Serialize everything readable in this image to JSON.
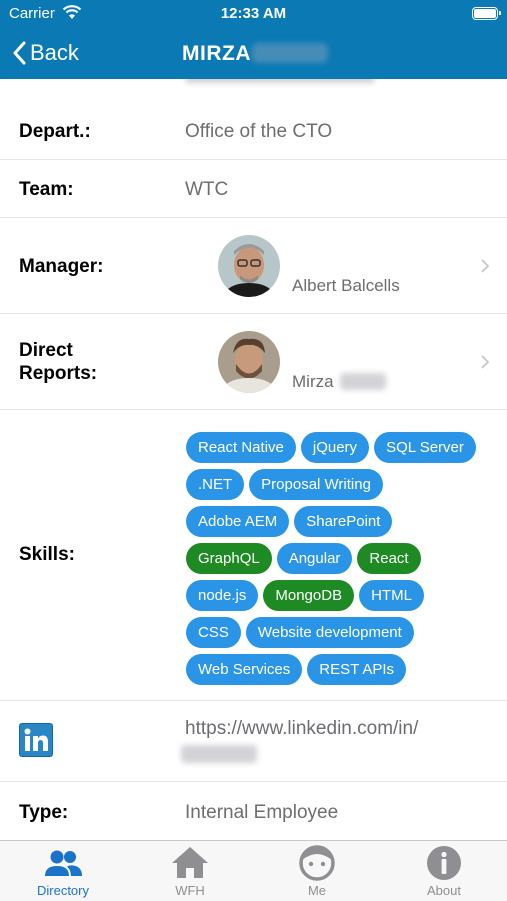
{
  "status_bar": {
    "carrier": "Carrier",
    "time": "12:33 AM"
  },
  "nav": {
    "back_label": "Back",
    "title": "MIRZA"
  },
  "profile": {
    "department": {
      "label": "Depart.:",
      "value": "Office of the CTO"
    },
    "team": {
      "label": "Team:",
      "value": "WTC"
    },
    "manager": {
      "label": "Manager:",
      "name": "Albert Balcells"
    },
    "direct_reports": {
      "label_line1": "Direct",
      "label_line2": "Reports:",
      "name": "Mirza"
    },
    "skills": {
      "label": "Skills:",
      "rows": [
        [
          {
            "name": "React Native",
            "color": "blue"
          },
          {
            "name": "jQuery",
            "color": "blue"
          },
          {
            "name": "SQL Server",
            "color": "blue"
          }
        ],
        [
          {
            "name": ".NET",
            "color": "blue"
          },
          {
            "name": "Proposal Writing",
            "color": "blue"
          }
        ],
        [
          {
            "name": "Adobe AEM",
            "color": "blue"
          },
          {
            "name": "SharePoint",
            "color": "blue"
          }
        ],
        [
          {
            "name": "GraphQL",
            "color": "green"
          },
          {
            "name": "Angular",
            "color": "blue"
          },
          {
            "name": "React",
            "color": "green"
          }
        ],
        [
          {
            "name": "node.js",
            "color": "blue"
          },
          {
            "name": "MongoDB",
            "color": "green"
          },
          {
            "name": "HTML",
            "color": "blue"
          }
        ],
        [
          {
            "name": "CSS",
            "color": "blue"
          },
          {
            "name": "Website development",
            "color": "blue"
          }
        ],
        [
          {
            "name": "Web Services",
            "color": "blue"
          },
          {
            "name": "REST APIs",
            "color": "blue"
          }
        ]
      ]
    },
    "linkedin": {
      "icon": "linkedin-icon",
      "url": "https://www.linkedin.com/in/"
    },
    "type": {
      "label": "Type:",
      "value": "Internal Employee"
    }
  },
  "tabs": [
    {
      "label": "Directory",
      "icon": "people-icon",
      "active": true
    },
    {
      "label": "WFH",
      "icon": "home-icon",
      "active": false
    },
    {
      "label": "Me",
      "icon": "face-icon",
      "active": false
    },
    {
      "label": "About",
      "icon": "info-icon",
      "active": false
    }
  ],
  "colors": {
    "brand": "#0a79b4",
    "chip_blue": "#2a95e7",
    "chip_green": "#1e8a24",
    "tab_active": "#1a73c9",
    "tab_inactive": "#8e8e93"
  }
}
